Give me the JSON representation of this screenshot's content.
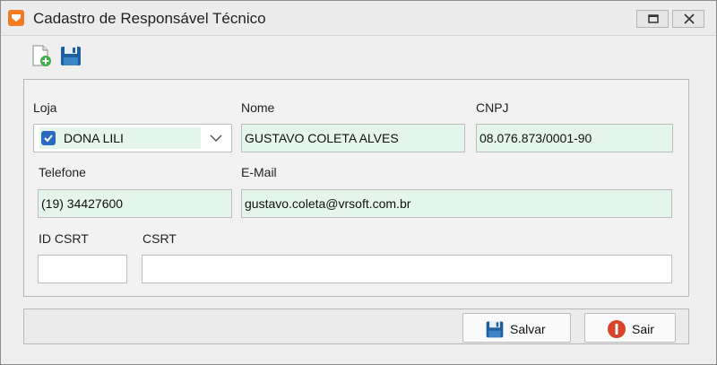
{
  "window": {
    "title": "Cadastro de Responsável Técnico"
  },
  "toolbar": {
    "new_icon": "new-document-icon",
    "save_icon": "floppy-disk-icon"
  },
  "form": {
    "loja": {
      "label": "Loja",
      "value": "DONA LILI",
      "checked": true
    },
    "nome": {
      "label": "Nome",
      "value": "GUSTAVO COLETA ALVES"
    },
    "cnpj": {
      "label": "CNPJ",
      "value": "08.076.873/0001-90"
    },
    "telefone": {
      "label": "Telefone",
      "value": "(19) 34427600"
    },
    "email": {
      "label": "E-Mail",
      "value": "gustavo.coleta@vrsoft.com.br"
    },
    "id_csrt": {
      "label": "ID CSRT",
      "value": ""
    },
    "csrt": {
      "label": "CSRT",
      "value": ""
    }
  },
  "actions": {
    "save_label": "Salvar",
    "exit_label": "Sair"
  },
  "colors": {
    "field_background": "#e4f5ec",
    "app_icon": "#f07b22",
    "checkbox": "#2b6bbf",
    "exit_icon": "#d8442b"
  }
}
